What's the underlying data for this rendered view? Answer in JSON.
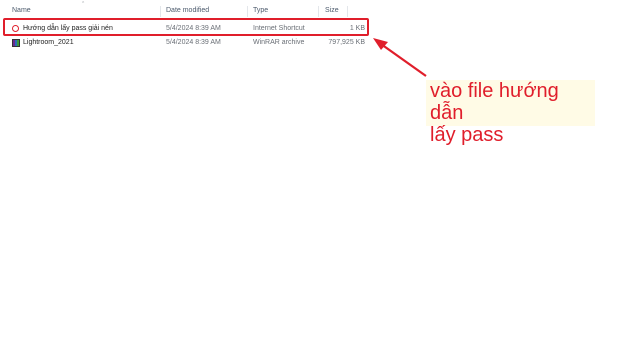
{
  "columns": {
    "name": "Name",
    "date_modified": "Date modified",
    "type": "Type",
    "size": "Size"
  },
  "files": [
    {
      "name": "Hướng dẫn lấy pass giải nén",
      "date_modified": "5/4/2024 8:39 AM",
      "type": "Internet Shortcut",
      "size": "1 KB",
      "icon": "opera-shortcut-icon"
    },
    {
      "name": "Lightroom_2021",
      "date_modified": "5/4/2024 8:39 AM",
      "type": "WinRAR archive",
      "size": "797,925 KB",
      "icon": "winrar-archive-icon"
    }
  ],
  "annotation": {
    "text": "vào file hướng dẫn\nlấy pass",
    "color": "#e01e2b",
    "background": "#fffbe6"
  }
}
